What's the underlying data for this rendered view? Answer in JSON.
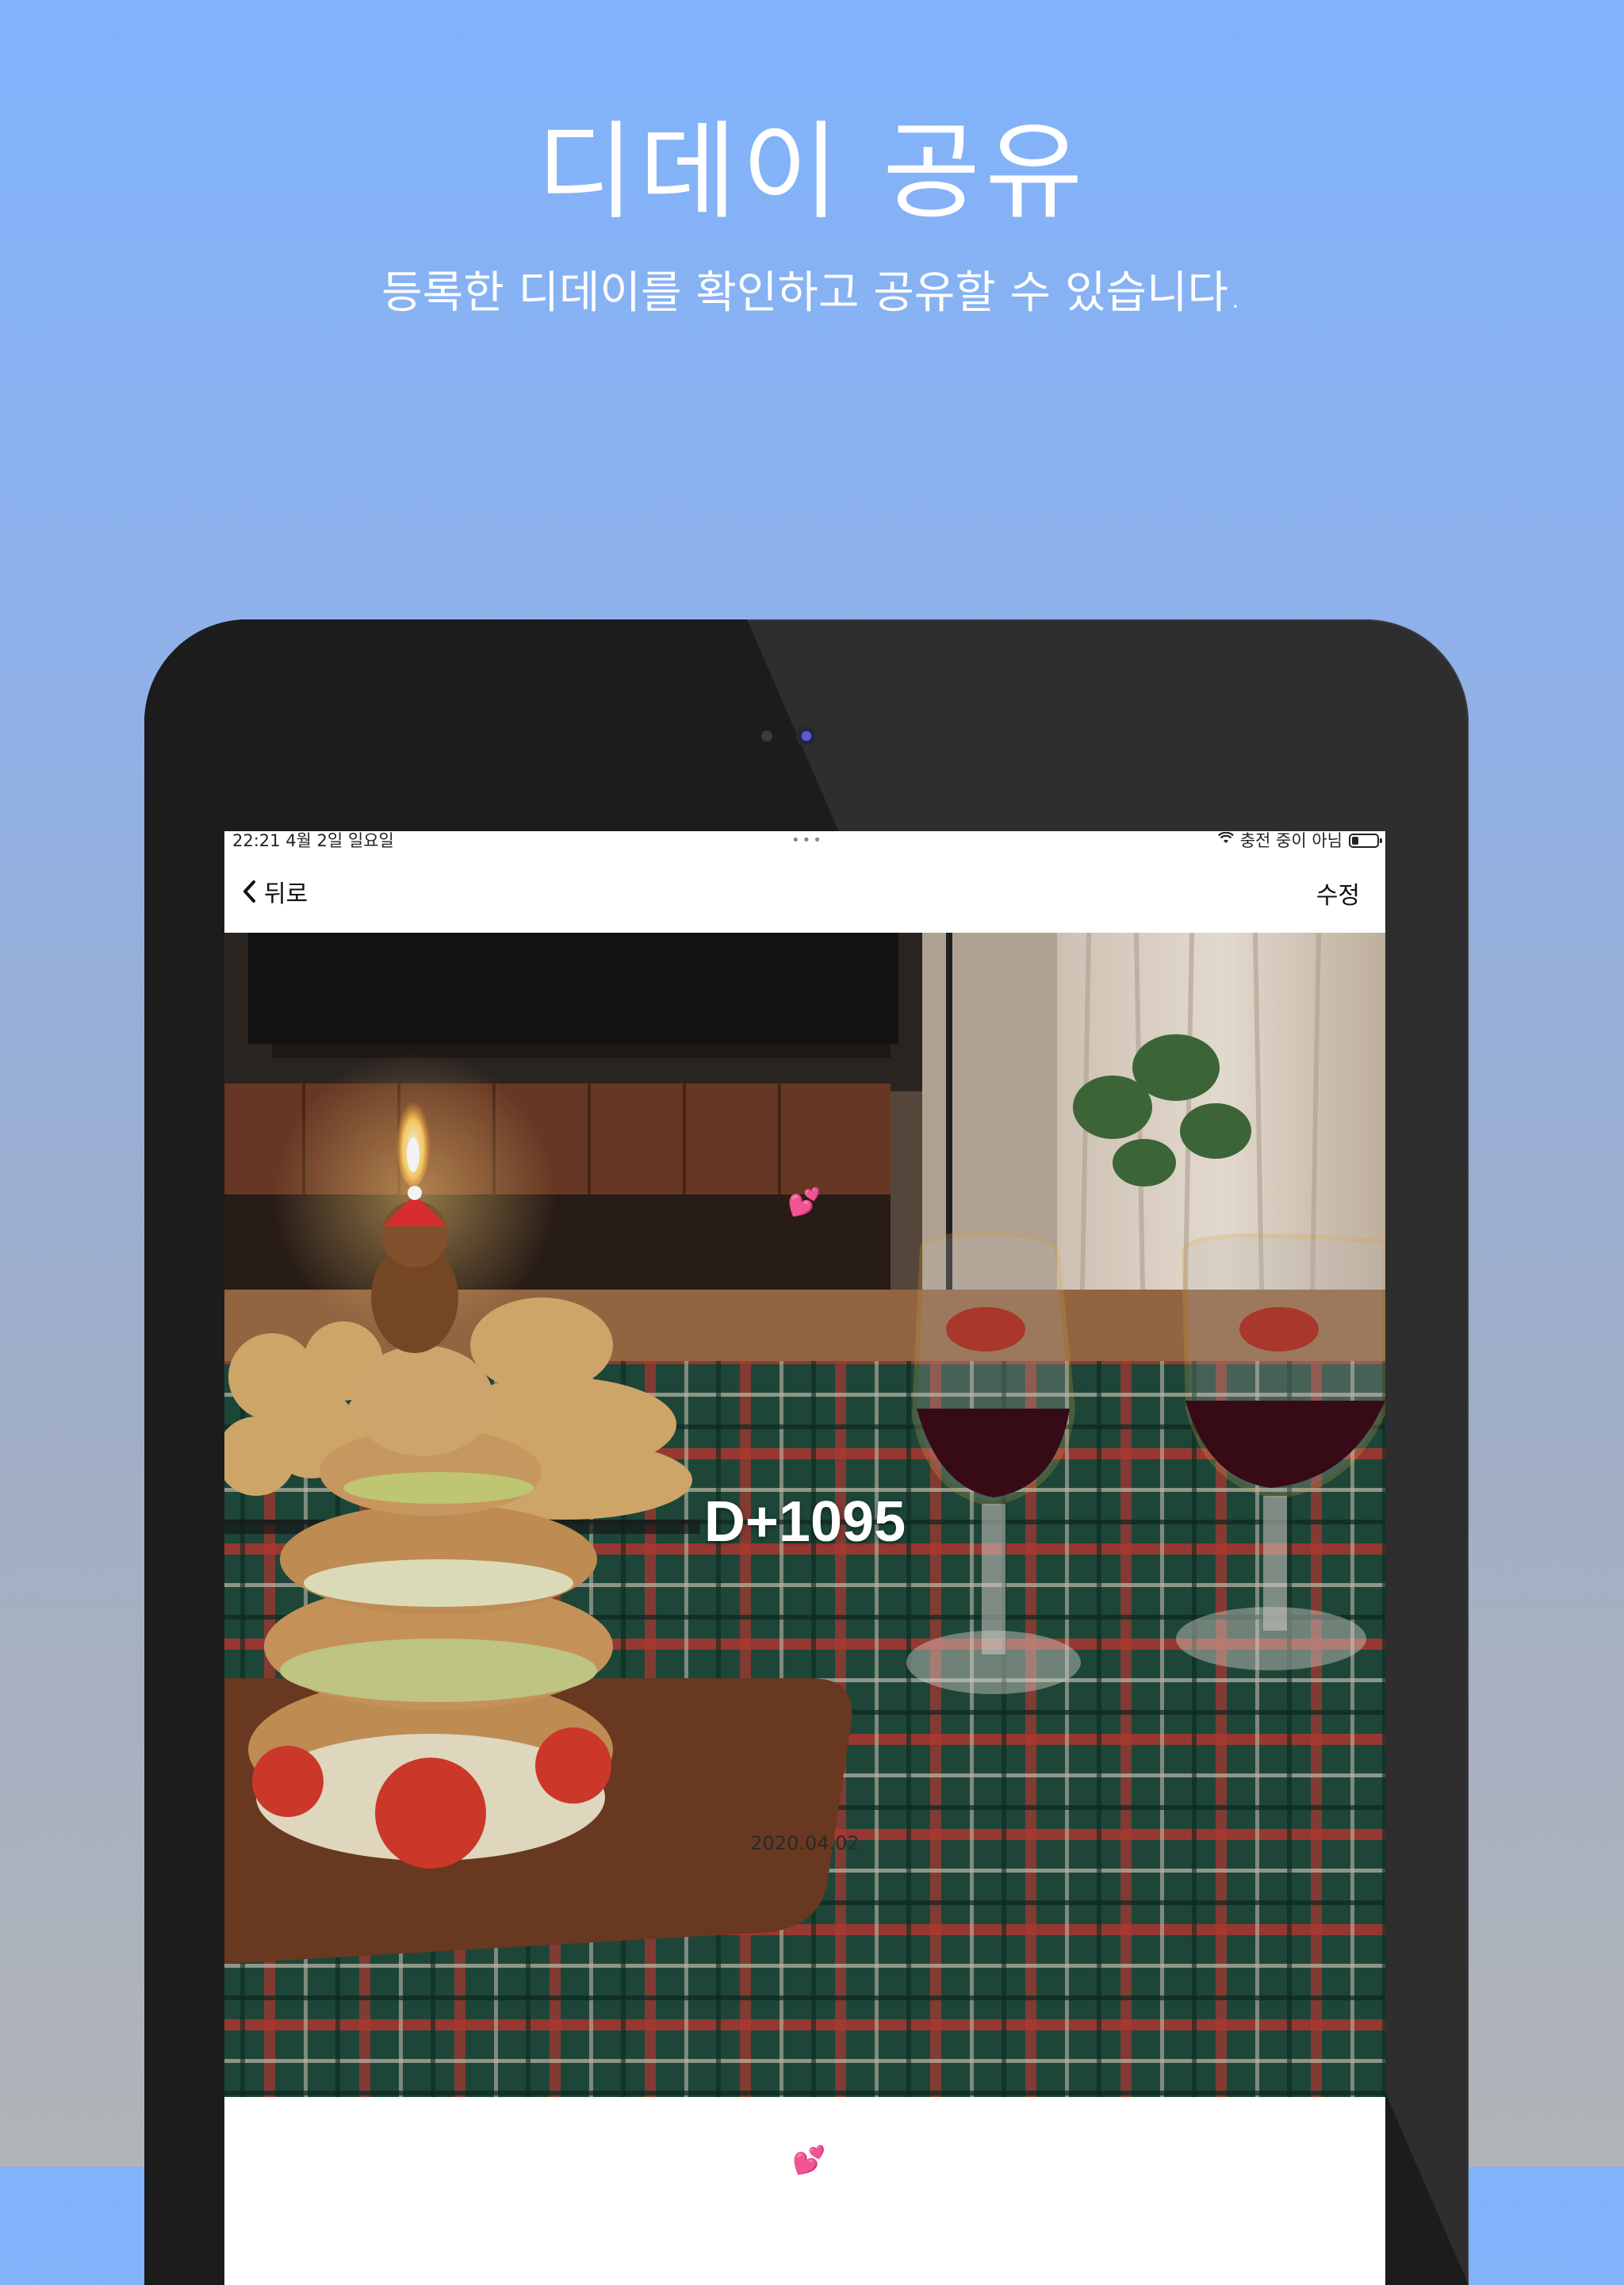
{
  "promo": {
    "title": "디데이 공유",
    "subtitle": "등록한 디데이를 확인하고 공유할 수 있습니다."
  },
  "status_bar": {
    "time_date": "22:21   4월 2일 일요일",
    "charging": "충전 중이 아님",
    "dots": "•••"
  },
  "nav": {
    "back_label": "뒤로",
    "edit_label": "수정"
  },
  "dday": {
    "count_label": "D+1095",
    "date": "2020.04.02",
    "emoji": "💕"
  },
  "colors": {
    "background_top": "#80b3fc",
    "background_bottom": "#b1b4b8",
    "tablet_bezel": "#2e2e2e"
  },
  "icons": {
    "back": "chevron-left-icon",
    "wifi": "wifi-icon",
    "battery": "battery-icon"
  }
}
